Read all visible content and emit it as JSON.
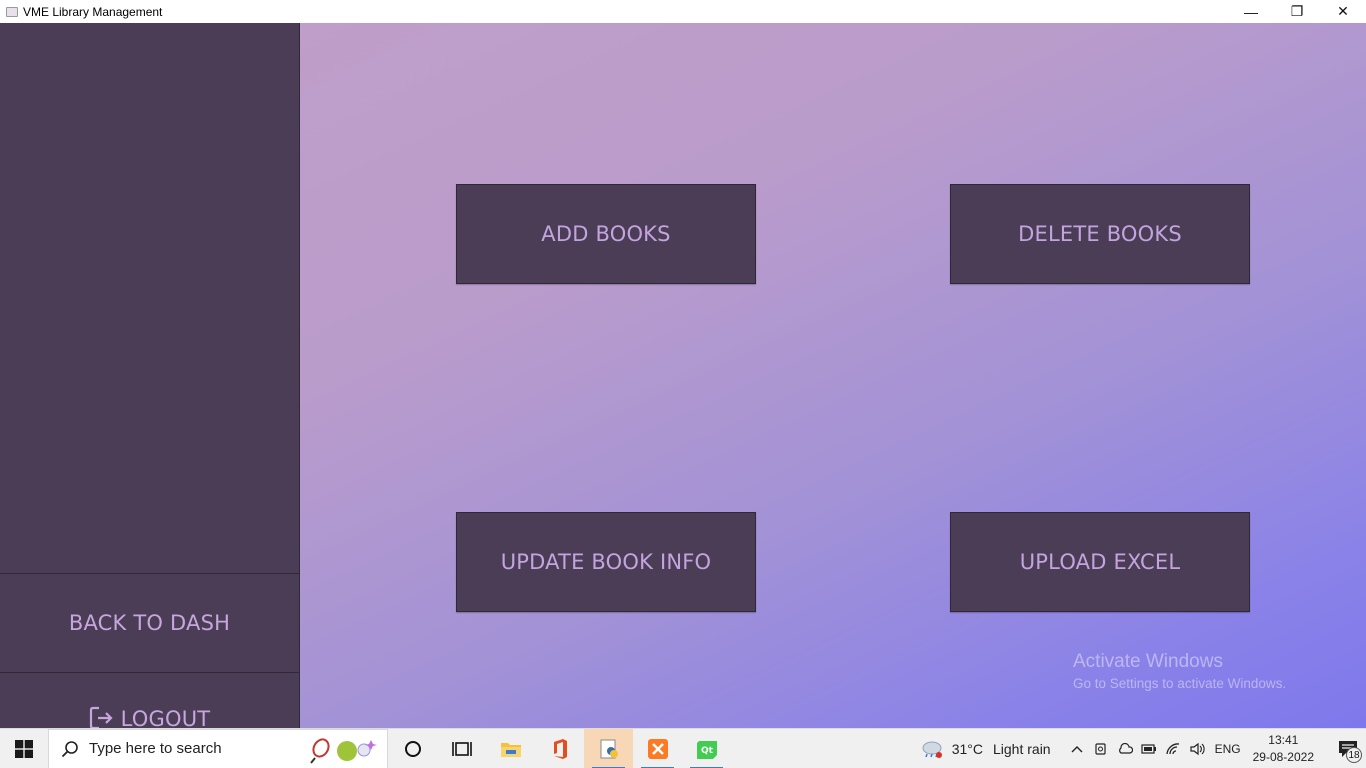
{
  "window": {
    "title": "VME Library Management",
    "minimize_glyph": "—",
    "restore_glyph": "❐",
    "close_glyph": "✕"
  },
  "sidebar": {
    "back_label": "BACK TO DASH",
    "logout_label": "LOGOUT"
  },
  "actions": {
    "add_books": "ADD BOOKS",
    "delete_books": "DELETE BOOKS",
    "update_book_info": "UPDATE BOOK INFO",
    "upload_excel": "UPLOAD EXCEL"
  },
  "watermark": {
    "title": "Activate Windows",
    "subtitle": "Go to Settings to activate Windows."
  },
  "taskbar": {
    "search_placeholder": "Type here to search",
    "weather_temp": "31°C",
    "weather_desc": "Light rain",
    "language": "ENG",
    "time": "13:41",
    "date": "29-08-2022",
    "notification_count": "18"
  },
  "colors": {
    "sidebar_bg": "#4a3d55",
    "button_text": "#c4a4de",
    "gradient_start": "#bf9ec9",
    "gradient_end": "#7e78ec"
  }
}
